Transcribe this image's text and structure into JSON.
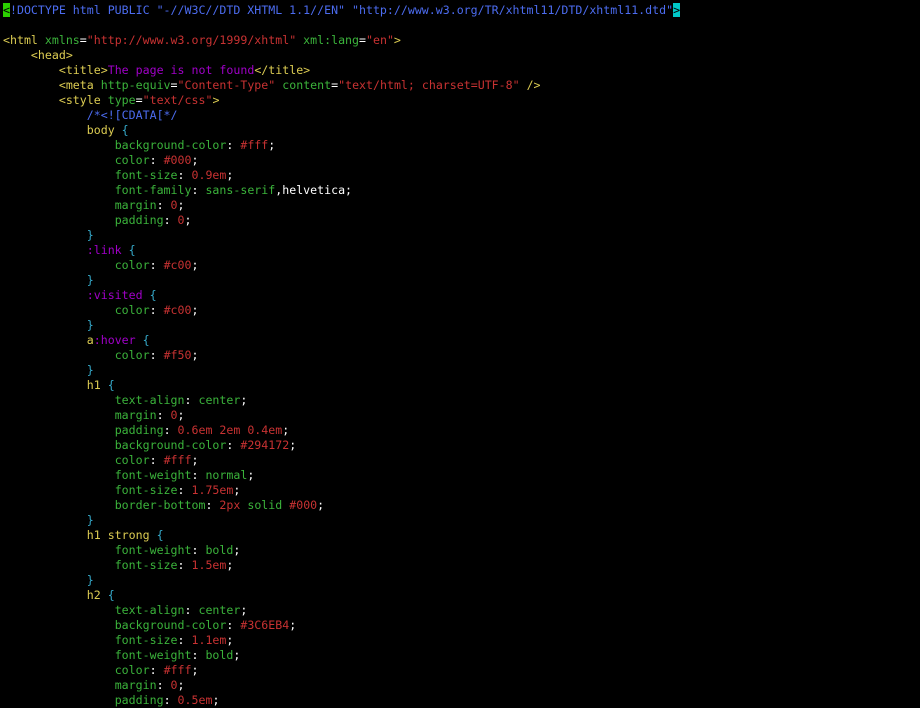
{
  "colors": {
    "background": "#000000",
    "default": "#ffffff",
    "tag": "#dccc52",
    "attr": "#3bb33b",
    "string": "#c83232",
    "selector": "#a000c8",
    "brace": "#35a8c8",
    "comment": "#4c6cf0",
    "cursor_start": "#2bd000",
    "cursor_end": "#00c8c8"
  },
  "lines": [
    {
      "segs": [
        [
          "cursor_start",
          "<"
        ],
        [
          "comment",
          "!DOCTYPE html PUBLIC \"-//W3C//DTD XHTML 1.1//EN\" \"http://www.w3.org/TR/xhtml11/DTD/xhtml11.dtd\""
        ],
        [
          "cursor_end",
          ">"
        ]
      ]
    },
    {
      "segs": []
    },
    {
      "segs": [
        [
          "tag",
          "<html "
        ],
        [
          "attr",
          "xmlns"
        ],
        [
          "default",
          "="
        ],
        [
          "string",
          "\"http://www.w3.org/1999/xhtml\""
        ],
        [
          "default",
          " "
        ],
        [
          "attr",
          "xml:lang"
        ],
        [
          "default",
          "="
        ],
        [
          "string",
          "\"en\""
        ],
        [
          "tag",
          ">"
        ]
      ]
    },
    {
      "segs": [
        [
          "default",
          "    "
        ],
        [
          "tag",
          "<head>"
        ]
      ]
    },
    {
      "segs": [
        [
          "default",
          "        "
        ],
        [
          "tag",
          "<title>"
        ],
        [
          "selector",
          "The page is not found"
        ],
        [
          "tag",
          "</title>"
        ]
      ]
    },
    {
      "segs": [
        [
          "default",
          "        "
        ],
        [
          "tag",
          "<meta "
        ],
        [
          "attr",
          "http-equiv"
        ],
        [
          "default",
          "="
        ],
        [
          "string",
          "\"Content-Type\""
        ],
        [
          "default",
          " "
        ],
        [
          "attr",
          "content"
        ],
        [
          "default",
          "="
        ],
        [
          "string",
          "\"text/html; charset=UTF-8\""
        ],
        [
          "tag",
          " />"
        ]
      ]
    },
    {
      "segs": [
        [
          "default",
          "        "
        ],
        [
          "tag",
          "<style "
        ],
        [
          "attr",
          "type"
        ],
        [
          "default",
          "="
        ],
        [
          "string",
          "\"text/css\""
        ],
        [
          "tag",
          ">"
        ]
      ]
    },
    {
      "segs": [
        [
          "default",
          "            "
        ],
        [
          "comment",
          "/*<![CDATA[*/"
        ]
      ]
    },
    {
      "segs": [
        [
          "default",
          "            "
        ],
        [
          "tag",
          "body"
        ],
        [
          "brace",
          " {"
        ]
      ]
    },
    {
      "segs": [
        [
          "default",
          "                "
        ],
        [
          "attr",
          "background-color"
        ],
        [
          "default",
          ": "
        ],
        [
          "string",
          "#fff"
        ],
        [
          "default",
          ";"
        ]
      ]
    },
    {
      "segs": [
        [
          "default",
          "                "
        ],
        [
          "attr",
          "color"
        ],
        [
          "default",
          ": "
        ],
        [
          "string",
          "#000"
        ],
        [
          "default",
          ";"
        ]
      ]
    },
    {
      "segs": [
        [
          "default",
          "                "
        ],
        [
          "attr",
          "font-size"
        ],
        [
          "default",
          ": "
        ],
        [
          "string",
          "0.9em"
        ],
        [
          "default",
          ";"
        ]
      ]
    },
    {
      "segs": [
        [
          "default",
          "                "
        ],
        [
          "attr",
          "font-family"
        ],
        [
          "default",
          ": "
        ],
        [
          "attr",
          "sans-serif"
        ],
        [
          "default",
          ",helvetica;"
        ]
      ]
    },
    {
      "segs": [
        [
          "default",
          "                "
        ],
        [
          "attr",
          "margin"
        ],
        [
          "default",
          ": "
        ],
        [
          "string",
          "0"
        ],
        [
          "default",
          ";"
        ]
      ]
    },
    {
      "segs": [
        [
          "default",
          "                "
        ],
        [
          "attr",
          "padding"
        ],
        [
          "default",
          ": "
        ],
        [
          "string",
          "0"
        ],
        [
          "default",
          ";"
        ]
      ]
    },
    {
      "segs": [
        [
          "default",
          "            "
        ],
        [
          "brace",
          "}"
        ]
      ]
    },
    {
      "segs": [
        [
          "default",
          "            "
        ],
        [
          "selector",
          ":link"
        ],
        [
          "brace",
          " {"
        ]
      ]
    },
    {
      "segs": [
        [
          "default",
          "                "
        ],
        [
          "attr",
          "color"
        ],
        [
          "default",
          ": "
        ],
        [
          "string",
          "#c00"
        ],
        [
          "default",
          ";"
        ]
      ]
    },
    {
      "segs": [
        [
          "default",
          "            "
        ],
        [
          "brace",
          "}"
        ]
      ]
    },
    {
      "segs": [
        [
          "default",
          "            "
        ],
        [
          "selector",
          ":visited"
        ],
        [
          "brace",
          " {"
        ]
      ]
    },
    {
      "segs": [
        [
          "default",
          "                "
        ],
        [
          "attr",
          "color"
        ],
        [
          "default",
          ": "
        ],
        [
          "string",
          "#c00"
        ],
        [
          "default",
          ";"
        ]
      ]
    },
    {
      "segs": [
        [
          "default",
          "            "
        ],
        [
          "brace",
          "}"
        ]
      ]
    },
    {
      "segs": [
        [
          "default",
          "            "
        ],
        [
          "tag",
          "a"
        ],
        [
          "selector",
          ":hover"
        ],
        [
          "brace",
          " {"
        ]
      ]
    },
    {
      "segs": [
        [
          "default",
          "                "
        ],
        [
          "attr",
          "color"
        ],
        [
          "default",
          ": "
        ],
        [
          "string",
          "#f50"
        ],
        [
          "default",
          ";"
        ]
      ]
    },
    {
      "segs": [
        [
          "default",
          "            "
        ],
        [
          "brace",
          "}"
        ]
      ]
    },
    {
      "segs": [
        [
          "default",
          "            "
        ],
        [
          "tag",
          "h1"
        ],
        [
          "brace",
          " {"
        ]
      ]
    },
    {
      "segs": [
        [
          "default",
          "                "
        ],
        [
          "attr",
          "text-align"
        ],
        [
          "default",
          ": "
        ],
        [
          "attr",
          "center"
        ],
        [
          "default",
          ";"
        ]
      ]
    },
    {
      "segs": [
        [
          "default",
          "                "
        ],
        [
          "attr",
          "margin"
        ],
        [
          "default",
          ": "
        ],
        [
          "string",
          "0"
        ],
        [
          "default",
          ";"
        ]
      ]
    },
    {
      "segs": [
        [
          "default",
          "                "
        ],
        [
          "attr",
          "padding"
        ],
        [
          "default",
          ": "
        ],
        [
          "string",
          "0.6em 2em 0.4em"
        ],
        [
          "default",
          ";"
        ]
      ]
    },
    {
      "segs": [
        [
          "default",
          "                "
        ],
        [
          "attr",
          "background-color"
        ],
        [
          "default",
          ": "
        ],
        [
          "string",
          "#294172"
        ],
        [
          "default",
          ";"
        ]
      ]
    },
    {
      "segs": [
        [
          "default",
          "                "
        ],
        [
          "attr",
          "color"
        ],
        [
          "default",
          ": "
        ],
        [
          "string",
          "#fff"
        ],
        [
          "default",
          ";"
        ]
      ]
    },
    {
      "segs": [
        [
          "default",
          "                "
        ],
        [
          "attr",
          "font-weight"
        ],
        [
          "default",
          ": "
        ],
        [
          "attr",
          "normal"
        ],
        [
          "default",
          ";"
        ]
      ]
    },
    {
      "segs": [
        [
          "default",
          "                "
        ],
        [
          "attr",
          "font-size"
        ],
        [
          "default",
          ": "
        ],
        [
          "string",
          "1.75em"
        ],
        [
          "default",
          ";"
        ]
      ]
    },
    {
      "segs": [
        [
          "default",
          "                "
        ],
        [
          "attr",
          "border-bottom"
        ],
        [
          "default",
          ": "
        ],
        [
          "string",
          "2px"
        ],
        [
          "default",
          " "
        ],
        [
          "attr",
          "solid"
        ],
        [
          "default",
          " "
        ],
        [
          "string",
          "#000"
        ],
        [
          "default",
          ";"
        ]
      ]
    },
    {
      "segs": [
        [
          "default",
          "            "
        ],
        [
          "brace",
          "}"
        ]
      ]
    },
    {
      "segs": [
        [
          "default",
          "            "
        ],
        [
          "tag",
          "h1 strong"
        ],
        [
          "brace",
          " {"
        ]
      ]
    },
    {
      "segs": [
        [
          "default",
          "                "
        ],
        [
          "attr",
          "font-weight"
        ],
        [
          "default",
          ": "
        ],
        [
          "attr",
          "bold"
        ],
        [
          "default",
          ";"
        ]
      ]
    },
    {
      "segs": [
        [
          "default",
          "                "
        ],
        [
          "attr",
          "font-size"
        ],
        [
          "default",
          ": "
        ],
        [
          "string",
          "1.5em"
        ],
        [
          "default",
          ";"
        ]
      ]
    },
    {
      "segs": [
        [
          "default",
          "            "
        ],
        [
          "brace",
          "}"
        ]
      ]
    },
    {
      "segs": [
        [
          "default",
          "            "
        ],
        [
          "tag",
          "h2"
        ],
        [
          "brace",
          " {"
        ]
      ]
    },
    {
      "segs": [
        [
          "default",
          "                "
        ],
        [
          "attr",
          "text-align"
        ],
        [
          "default",
          ": "
        ],
        [
          "attr",
          "center"
        ],
        [
          "default",
          ";"
        ]
      ]
    },
    {
      "segs": [
        [
          "default",
          "                "
        ],
        [
          "attr",
          "background-color"
        ],
        [
          "default",
          ": "
        ],
        [
          "string",
          "#3C6EB4"
        ],
        [
          "default",
          ";"
        ]
      ]
    },
    {
      "segs": [
        [
          "default",
          "                "
        ],
        [
          "attr",
          "font-size"
        ],
        [
          "default",
          ": "
        ],
        [
          "string",
          "1.1em"
        ],
        [
          "default",
          ";"
        ]
      ]
    },
    {
      "segs": [
        [
          "default",
          "                "
        ],
        [
          "attr",
          "font-weight"
        ],
        [
          "default",
          ": "
        ],
        [
          "attr",
          "bold"
        ],
        [
          "default",
          ";"
        ]
      ]
    },
    {
      "segs": [
        [
          "default",
          "                "
        ],
        [
          "attr",
          "color"
        ],
        [
          "default",
          ": "
        ],
        [
          "string",
          "#fff"
        ],
        [
          "default",
          ";"
        ]
      ]
    },
    {
      "segs": [
        [
          "default",
          "                "
        ],
        [
          "attr",
          "margin"
        ],
        [
          "default",
          ": "
        ],
        [
          "string",
          "0"
        ],
        [
          "default",
          ";"
        ]
      ]
    },
    {
      "segs": [
        [
          "default",
          "                "
        ],
        [
          "attr",
          "padding"
        ],
        [
          "default",
          ": "
        ],
        [
          "string",
          "0.5em"
        ],
        [
          "default",
          ";"
        ]
      ]
    }
  ]
}
